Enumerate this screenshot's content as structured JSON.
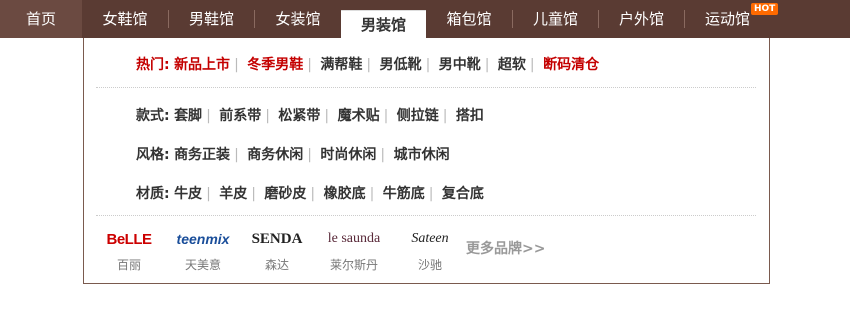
{
  "nav": {
    "home": "首页",
    "items": [
      "女鞋馆",
      "男鞋馆",
      "女装馆",
      "男装馆",
      "箱包馆",
      "儿童馆",
      "户外馆",
      "运动馆"
    ],
    "hot_badge": "HOT"
  },
  "hot": {
    "label": "热门:",
    "links": [
      "新品上市",
      "冬季男鞋",
      "满帮鞋",
      "男低靴",
      "男中靴",
      "超软",
      "断码清仓"
    ]
  },
  "style": {
    "label": "款式:",
    "links": [
      "套脚",
      "前系带",
      "松紧带",
      "魔术贴",
      "侧拉链",
      "搭扣"
    ]
  },
  "fengge": {
    "label": "风格:",
    "links": [
      "商务正装",
      "商务休闲",
      "时尚休闲",
      "城市休闲"
    ]
  },
  "material": {
    "label": "材质:",
    "links": [
      "牛皮",
      "羊皮",
      "磨砂皮",
      "橡胶底",
      "牛筋底",
      "复合底"
    ]
  },
  "brands": [
    {
      "logo": "BeLLE",
      "name": "百丽"
    },
    {
      "logo": "teenmix",
      "name": "天美意"
    },
    {
      "logo": "SENDA",
      "name": "森达"
    },
    {
      "logo": "le saunda",
      "name": "莱尔斯丹"
    },
    {
      "logo": "Sateen",
      "name": "沙驰"
    }
  ],
  "more_brands": "更多品牌>>",
  "colors": {
    "nav_bg": "#5a3b33",
    "hot_red": "#c40000",
    "belle_red": "#cc0000",
    "teenmix_blue": "#1a4e9a"
  }
}
